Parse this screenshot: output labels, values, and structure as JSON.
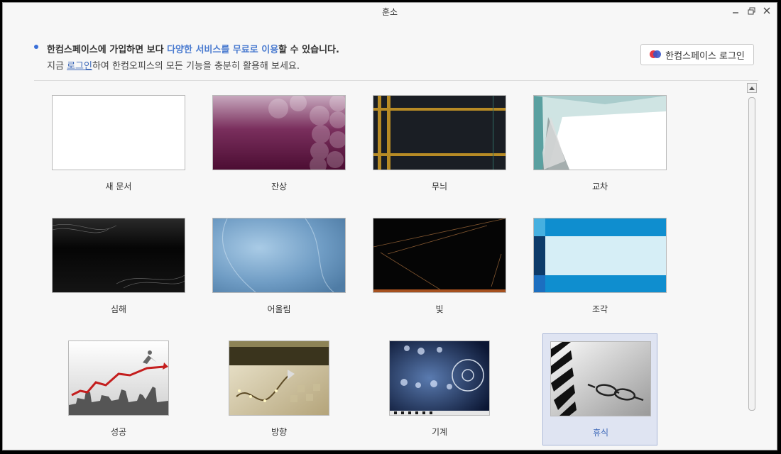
{
  "window": {
    "title": "훈소"
  },
  "banner": {
    "line1_a": "한컴스페이스에 가입하면 보다 ",
    "line1_hl": "다양한 서비스를 무료로 이용",
    "line1_b": "할 수 있습니다.",
    "line2_a": "지금 ",
    "line2_link": "로그인",
    "line2_b": "하여 한컴오피스의 모든 기능을 충분히 활용해 보세요.",
    "login_button": "한컴스페이스 로그인"
  },
  "templates": [
    {
      "label": "새 문서",
      "style": "blank"
    },
    {
      "label": "잔상",
      "style": "afterimage"
    },
    {
      "label": "무늬",
      "style": "pattern"
    },
    {
      "label": "교차",
      "style": "cross"
    },
    {
      "label": "심해",
      "style": "deepsea"
    },
    {
      "label": "어울림",
      "style": "harmony"
    },
    {
      "label": "빛",
      "style": "light"
    },
    {
      "label": "조각",
      "style": "piece"
    },
    {
      "label": "성공",
      "style": "success"
    },
    {
      "label": "방향",
      "style": "direction"
    },
    {
      "label": "기계",
      "style": "machine"
    },
    {
      "label": "휴식",
      "style": "rest",
      "selected": true
    }
  ]
}
